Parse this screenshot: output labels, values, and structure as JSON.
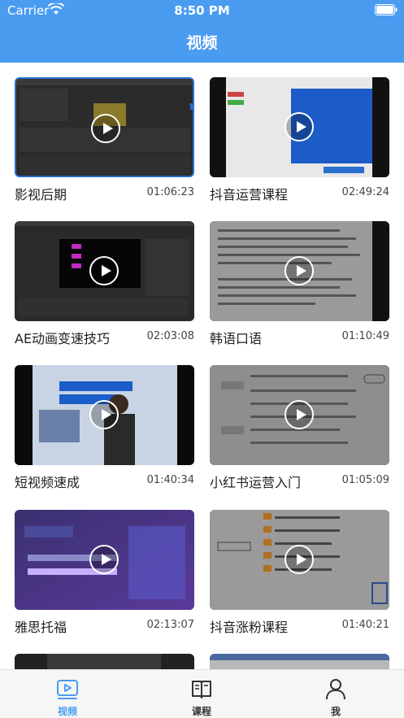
{
  "status_bar": {
    "carrier": "Carrier",
    "time": "8:50 PM"
  },
  "nav": {
    "title": "视频"
  },
  "videos": [
    {
      "title": "影视后期",
      "duration": "01:06:23",
      "thumb": "editor-screen"
    },
    {
      "title": "抖音运营课程",
      "duration": "02:49:24",
      "thumb": "blue-banner"
    },
    {
      "title": "AE动画变速技巧",
      "duration": "02:03:08",
      "thumb": "dark-editor"
    },
    {
      "title": "韩语口语",
      "duration": "01:10:49",
      "thumb": "text-document"
    },
    {
      "title": "短视频速成",
      "duration": "01:40:34",
      "thumb": "presenter-slide"
    },
    {
      "title": "小红书运营入门",
      "duration": "01:05:09",
      "thumb": "mindmap"
    },
    {
      "title": "雅思托福",
      "duration": "02:13:07",
      "thumb": "purple-promo"
    },
    {
      "title": "抖音涨粉课程",
      "duration": "01:40:21",
      "thumb": "mindmap-orange"
    }
  ],
  "tabs": [
    {
      "label": "视频",
      "icon": "video-icon",
      "active": true
    },
    {
      "label": "课程",
      "icon": "book-icon",
      "active": false
    },
    {
      "label": "我",
      "icon": "person-icon",
      "active": false
    }
  ],
  "colors": {
    "accent": "#4a9cf0",
    "tab_bar": "#f6f6f6"
  }
}
